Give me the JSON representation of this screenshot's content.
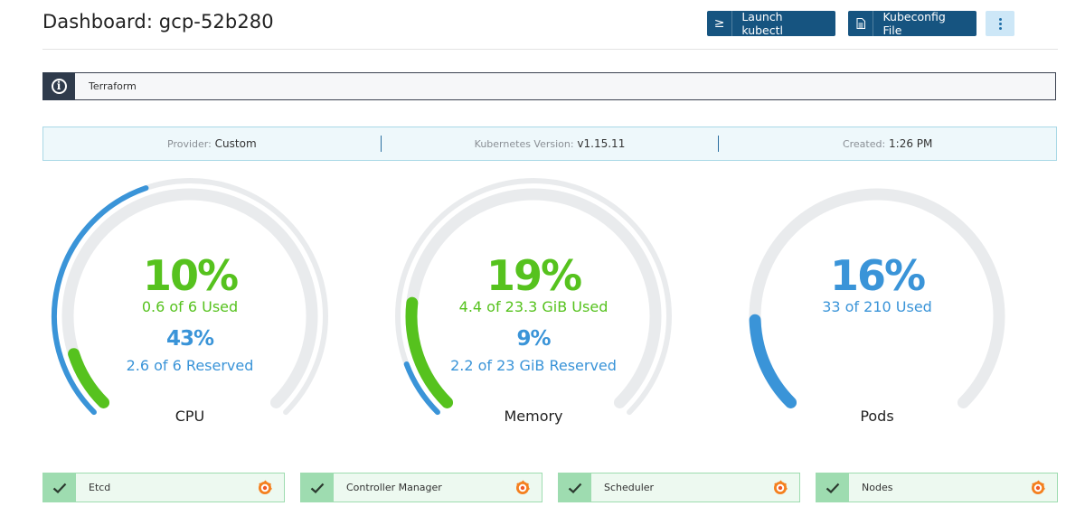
{
  "header": {
    "title": "Dashboard: gcp-52b280",
    "launch_label": "Launch kubectl",
    "launch_icon": "terminal-icon",
    "kubeconfig_label": "Kubeconfig File",
    "kubeconfig_icon": "file-icon",
    "more_icon": "vertical-dots-icon"
  },
  "banner": {
    "icon": "info-icon",
    "text": "Terraform"
  },
  "meta": [
    {
      "key": "Provider:",
      "value": "Custom"
    },
    {
      "key": "Kubernetes Version:",
      "value": "v1.15.11"
    },
    {
      "key": "Created:",
      "value": "1:26 PM"
    }
  ],
  "gauges": [
    {
      "name": "CPU",
      "used_pct": "10%",
      "used_text": "0.6 of 6 Used",
      "reserved_pct": "43%",
      "reserved_text": "2.6 of 6 Reserved",
      "used_value": 0.1,
      "reserved_value": 0.43
    },
    {
      "name": "Memory",
      "used_pct": "19%",
      "used_text": "4.4 of 23.3 GiB Used",
      "reserved_pct": "9%",
      "reserved_text": "2.2 of 23 GiB Reserved",
      "used_value": 0.19,
      "reserved_value": 0.09
    },
    {
      "name": "Pods",
      "used_pct": "16%",
      "used_text": "33 of 210 Used",
      "used_value": 0.16
    }
  ],
  "components": [
    {
      "name": "Etcd",
      "status_icon": "check-icon",
      "link_icon": "grafana-icon"
    },
    {
      "name": "Controller Manager",
      "status_icon": "check-icon",
      "link_icon": "grafana-icon"
    },
    {
      "name": "Scheduler",
      "status_icon": "check-icon",
      "link_icon": "grafana-icon"
    },
    {
      "name": "Nodes",
      "status_icon": "check-icon",
      "link_icon": "grafana-icon"
    }
  ],
  "colors": {
    "primary": "#165480",
    "used": "#56c21e",
    "reserved": "#3a94d8",
    "track": "#e9ebed",
    "ok": "#9edcb0"
  }
}
